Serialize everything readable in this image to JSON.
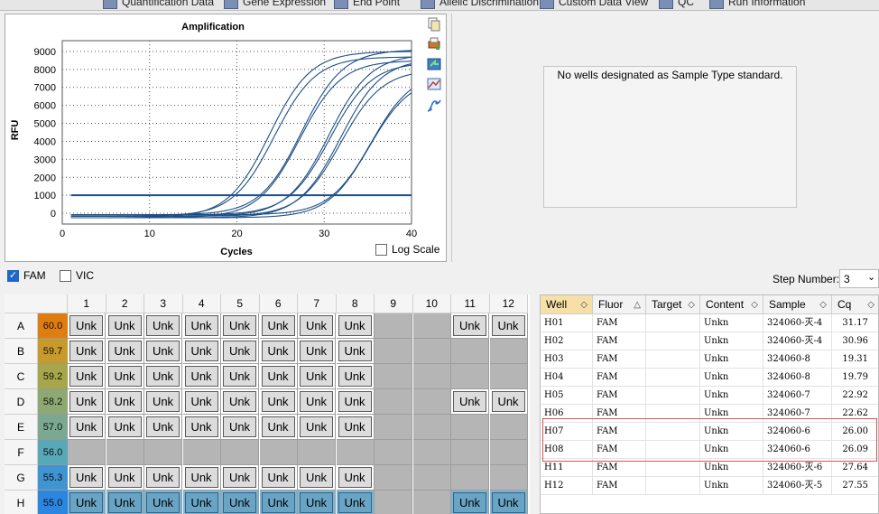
{
  "tabs": [
    "Quantification Data",
    "Gene Expression",
    "End Point",
    "Allelic Discrimination",
    "Custom Data View",
    "QC",
    "Run Information"
  ],
  "chart": {
    "title": "Amplification",
    "ylabel": "RFU",
    "xlabel": "Cycles",
    "log_scale_label": "Log Scale"
  },
  "message": "No wells designated as Sample Type standard.",
  "fluors": {
    "fam_label": "FAM",
    "vic_label": "VIC"
  },
  "step": {
    "label": "Step Number:",
    "value": "3"
  },
  "chart_data": {
    "type": "line",
    "xlim": [
      0,
      40
    ],
    "ylim": [
      -600,
      9600
    ],
    "xticks": [
      0,
      10,
      20,
      30,
      40
    ],
    "yticks": [
      0,
      1000,
      2000,
      3000,
      4000,
      5000,
      6000,
      7000,
      8000,
      9000
    ],
    "grid": true,
    "threshold": 1000,
    "cq_values": [
      19.31,
      19.79,
      22.62,
      22.92,
      26.0,
      26.09,
      27.55,
      27.64,
      30.96,
      31.17
    ],
    "plateaus": [
      9000,
      8700,
      9100,
      8500,
      8850,
      8400,
      8600,
      8000,
      7900,
      7600
    ]
  },
  "plate": {
    "columns": [
      "1",
      "2",
      "3",
      "4",
      "5",
      "6",
      "7",
      "8",
      "9",
      "10",
      "11",
      "12"
    ],
    "rows": [
      {
        "label": "A",
        "temp": "60.0",
        "color": "#e07d10",
        "cells": [
          "Unk",
          "Unk",
          "Unk",
          "Unk",
          "Unk",
          "Unk",
          "Unk",
          "Unk",
          "",
          "",
          "Unk",
          "Unk"
        ]
      },
      {
        "label": "B",
        "temp": "59.7",
        "color": "#c89a2a",
        "cells": [
          "Unk",
          "Unk",
          "Unk",
          "Unk",
          "Unk",
          "Unk",
          "Unk",
          "Unk",
          "",
          "",
          "",
          ""
        ]
      },
      {
        "label": "C",
        "temp": "59.2",
        "color": "#a8a64a",
        "cells": [
          "Unk",
          "Unk",
          "Unk",
          "Unk",
          "Unk",
          "Unk",
          "Unk",
          "Unk",
          "",
          "",
          "",
          ""
        ]
      },
      {
        "label": "D",
        "temp": "58.2",
        "color": "#8ea872",
        "cells": [
          "Unk",
          "Unk",
          "Unk",
          "Unk",
          "Unk",
          "Unk",
          "Unk",
          "Unk",
          "",
          "",
          "Unk",
          "Unk"
        ]
      },
      {
        "label": "E",
        "temp": "57.0",
        "color": "#7aa890",
        "cells": [
          "Unk",
          "Unk",
          "Unk",
          "Unk",
          "Unk",
          "Unk",
          "Unk",
          "Unk",
          "",
          "",
          "",
          ""
        ]
      },
      {
        "label": "F",
        "temp": "56.0",
        "color": "#58a8b8",
        "cells": [
          "",
          "",
          "",
          "",
          "",
          "",
          "",
          "",
          "",
          "",
          "",
          ""
        ]
      },
      {
        "label": "G",
        "temp": "55.3",
        "color": "#3f94d2",
        "cells": [
          "Unk",
          "Unk",
          "Unk",
          "Unk",
          "Unk",
          "Unk",
          "Unk",
          "Unk",
          "",
          "",
          "",
          ""
        ]
      },
      {
        "label": "H",
        "temp": "55.0",
        "color": "#2a86e0",
        "cells": [
          "Unk",
          "Unk",
          "Unk",
          "Unk",
          "Unk",
          "Unk",
          "Unk",
          "Unk",
          "",
          "",
          "Unk",
          "Unk"
        ]
      }
    ]
  },
  "results": {
    "headers": [
      "Well",
      "Fluor",
      "Target",
      "Content",
      "Sample",
      "Cq"
    ],
    "rows": [
      {
        "well": "H01",
        "fluor": "FAM",
        "target": "",
        "content": "Unkn",
        "sample": "324060-灭-4",
        "cq": "31.17"
      },
      {
        "well": "H02",
        "fluor": "FAM",
        "target": "",
        "content": "Unkn",
        "sample": "324060-灭-4",
        "cq": "30.96"
      },
      {
        "well": "H03",
        "fluor": "FAM",
        "target": "",
        "content": "Unkn",
        "sample": "324060-8",
        "cq": "19.31"
      },
      {
        "well": "H04",
        "fluor": "FAM",
        "target": "",
        "content": "Unkn",
        "sample": "324060-8",
        "cq": "19.79"
      },
      {
        "well": "H05",
        "fluor": "FAM",
        "target": "",
        "content": "Unkn",
        "sample": "324060-7",
        "cq": "22.92"
      },
      {
        "well": "H06",
        "fluor": "FAM",
        "target": "",
        "content": "Unkn",
        "sample": "324060-7",
        "cq": "22.62"
      },
      {
        "well": "H07",
        "fluor": "FAM",
        "target": "",
        "content": "Unkn",
        "sample": "324060-6",
        "cq": "26.00"
      },
      {
        "well": "H08",
        "fluor": "FAM",
        "target": "",
        "content": "Unkn",
        "sample": "324060-6",
        "cq": "26.09"
      },
      {
        "well": "H11",
        "fluor": "FAM",
        "target": "",
        "content": "Unkn",
        "sample": "324060-灭-6",
        "cq": "27.64"
      },
      {
        "well": "H12",
        "fluor": "FAM",
        "target": "",
        "content": "Unkn",
        "sample": "324060-灭-5",
        "cq": "27.55"
      }
    ]
  }
}
